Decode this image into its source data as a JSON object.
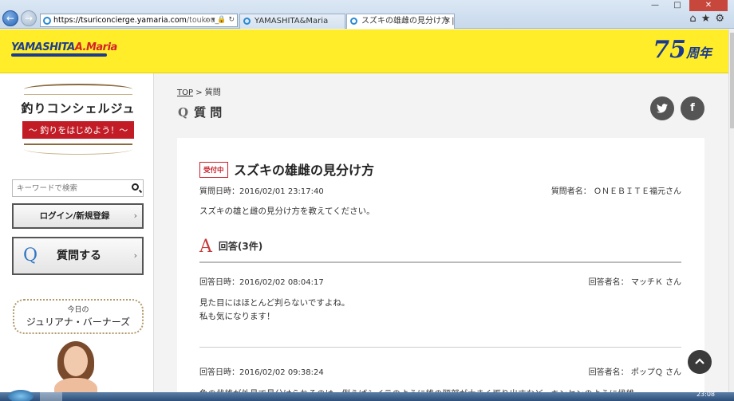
{
  "browser": {
    "url_host": "https://tsuriconcierge.yamaria.com",
    "url_rest": "/toukou_d",
    "tabs": [
      {
        "label": "YAMASHITA&Maria"
      },
      {
        "label": "スズキの雄雌の見分け方 |...",
        "active": true
      }
    ],
    "address_controls": "⌕ ▾ 🔒 ↻",
    "icons": [
      "home-icon",
      "star-icon",
      "gear-icon"
    ]
  },
  "header": {
    "logo_text_1": "YAMASHITA",
    "logo_text_2": "A.Maria",
    "anniversary_number": "75",
    "anniversary_suffix": "周年"
  },
  "sidebar": {
    "concierge_title": "釣りコンシェルジュ",
    "concierge_sub": "〜 釣りをはじめよう！〜",
    "search_placeholder": "キーワードで検索",
    "login_label": "ログイン/新規登録",
    "ask_icon": "Q",
    "ask_label": "質問する",
    "today_small": "今日の",
    "today_name": "ジュリアナ・バーナーズ"
  },
  "main": {
    "breadcrumb_top": "TOP",
    "breadcrumb_sep": ">",
    "breadcrumb_current": "質問",
    "title_q": "Q",
    "title": "質 問",
    "social": [
      "twitter-icon",
      "facebook-icon"
    ],
    "question": {
      "status_badge": "受付中",
      "title": "スズキの雄雌の見分け方",
      "date": "質問日時：2016/02/01 23:17:40",
      "author": "質問者名： ＯＮＥＢＩＴＥ福元さん",
      "body": "スズキの雄と雌の見分け方を教えてください。"
    },
    "answers_icon": "A",
    "answers_header": "回答(3件)",
    "answers": [
      {
        "date": "回答日時：2016/02/02 08:04:17",
        "author": "回答者名： マッチＫ さん",
        "body_line1": "見た目にはほとんど判らないですよね。",
        "body_line2": "私も気になります！"
      },
      {
        "date": "回答日時：2016/02/02 09:38:24",
        "author": "回答者名： ポップＱ さん",
        "body_line1": "魚の雌雄が外見で見分けられるのは、例えばシイラのように雄の頭部が大きく張り出すなど、キンセンのように雌雄"
      }
    ]
  },
  "taskbar": {
    "clock": "23:08"
  },
  "colors": {
    "header_yellow": "#ffed2a",
    "brand_blue": "#1d3c8f",
    "badge_red": "#c8202a",
    "answer_red": "#c43a3a",
    "ask_blue": "#3377c4"
  }
}
